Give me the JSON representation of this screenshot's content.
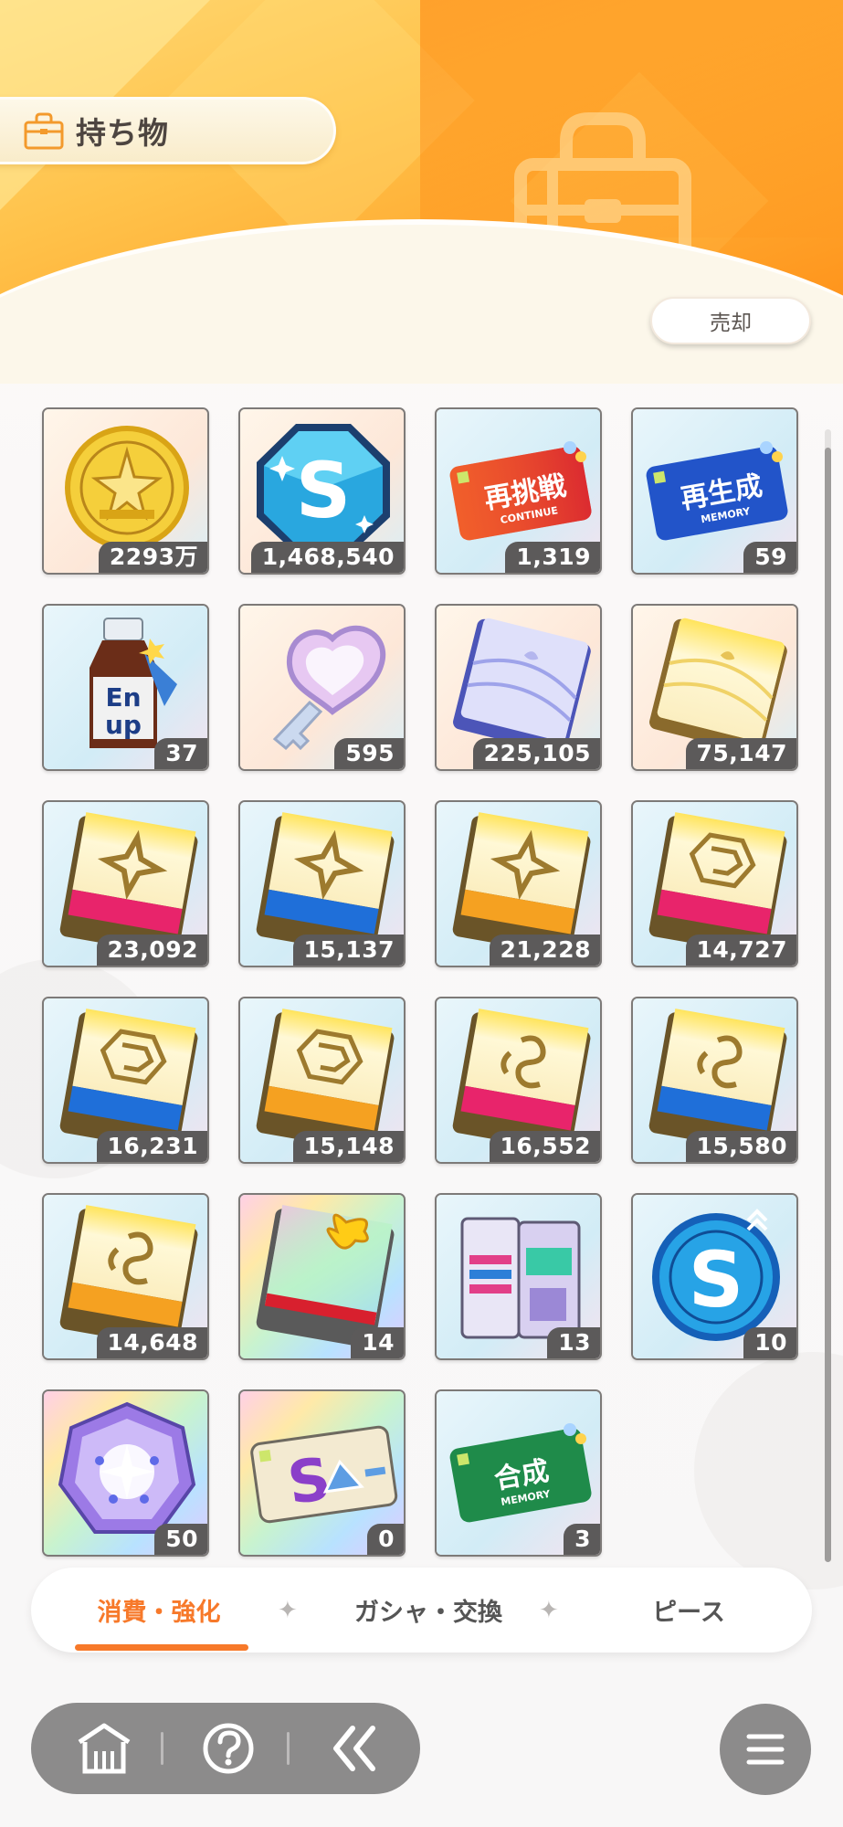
{
  "header": {
    "title": "持ち物",
    "sell_label": "売却",
    "colors": {
      "accent": "#f7792a",
      "header_orange": "#ff9a1f"
    }
  },
  "items": [
    {
      "name": "gold-coin-icon",
      "count": "2293万"
    },
    {
      "name": "star-gem-s-icon",
      "count": "1,468,540"
    },
    {
      "name": "continue-ticket-icon",
      "count": "1,319",
      "label": "再挑戦",
      "sub": "CONTINUE"
    },
    {
      "name": "memory-regenerate-ticket-icon",
      "count": "59",
      "label": "再生成",
      "sub": "MEMORY"
    },
    {
      "name": "energy-drink-icon",
      "count": "37"
    },
    {
      "name": "heart-key-icon",
      "count": "595"
    },
    {
      "name": "purple-book-icon",
      "count": "225,105"
    },
    {
      "name": "gold-book-icon",
      "count": "75,147"
    },
    {
      "name": "sparkle-book-pink-icon",
      "count": "23,092"
    },
    {
      "name": "sparkle-book-blue-icon",
      "count": "15,137"
    },
    {
      "name": "sparkle-book-orange-icon",
      "count": "21,228"
    },
    {
      "name": "maze-book-pink-icon",
      "count": "14,727"
    },
    {
      "name": "maze-book-blue-icon",
      "count": "16,231"
    },
    {
      "name": "maze-book-orange-icon",
      "count": "15,148"
    },
    {
      "name": "swirl-book-pink-icon",
      "count": "16,552"
    },
    {
      "name": "swirl-book-blue-icon",
      "count": "15,580"
    },
    {
      "name": "swirl-book-orange-icon",
      "count": "14,648"
    },
    {
      "name": "gift-book-icon",
      "count": "14"
    },
    {
      "name": "book-set-icon",
      "count": "13"
    },
    {
      "name": "s-rank-up-coin-icon",
      "count": "10"
    },
    {
      "name": "crystal-gem-icon",
      "count": "50"
    },
    {
      "name": "s-upgrade-ticket-icon",
      "count": "0"
    },
    {
      "name": "memory-synthesis-ticket-icon",
      "count": "3",
      "label": "合成",
      "sub": "MEMORY"
    }
  ],
  "tabs": [
    {
      "label": "消費・強化",
      "active": true
    },
    {
      "label": "ガシャ・交換",
      "active": false
    },
    {
      "label": "ピース",
      "active": false
    }
  ],
  "nav": {
    "home": "home-icon",
    "help": "help-icon",
    "back": "back-icon",
    "menu": "menu-icon"
  }
}
